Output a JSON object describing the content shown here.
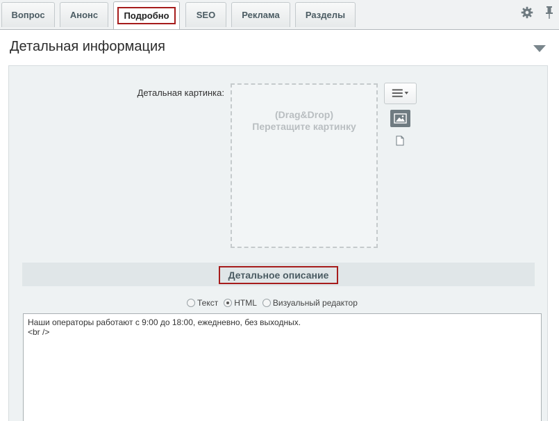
{
  "tabs": [
    {
      "label": "Вопрос"
    },
    {
      "label": "Анонс"
    },
    {
      "label": "Подробно"
    },
    {
      "label": "SEO"
    },
    {
      "label": "Реклама"
    },
    {
      "label": "Разделы"
    }
  ],
  "section": {
    "title": "Детальная информация"
  },
  "picture": {
    "label": "Детальная картинка:",
    "drop_line1": "(Drag&Drop)",
    "drop_line2": "Перетащите картинку"
  },
  "description": {
    "title": "Детальное описание",
    "modes": [
      {
        "label": "Текст",
        "selected": false
      },
      {
        "label": "HTML",
        "selected": true
      },
      {
        "label": "Визуальный редактор",
        "selected": false
      }
    ],
    "content": "Наши операторы работают с 9:00 до 18:00, ежедневно, без выходных.\n<br />"
  },
  "icons": {
    "settings": "gear-icon",
    "pin": "pin-icon",
    "collapse": "chevron-down-icon",
    "menu": "menu-icon",
    "image": "image-icon",
    "file": "file-icon"
  },
  "colors": {
    "highlight": "#a61c1c",
    "panel": "#eef2f3"
  }
}
